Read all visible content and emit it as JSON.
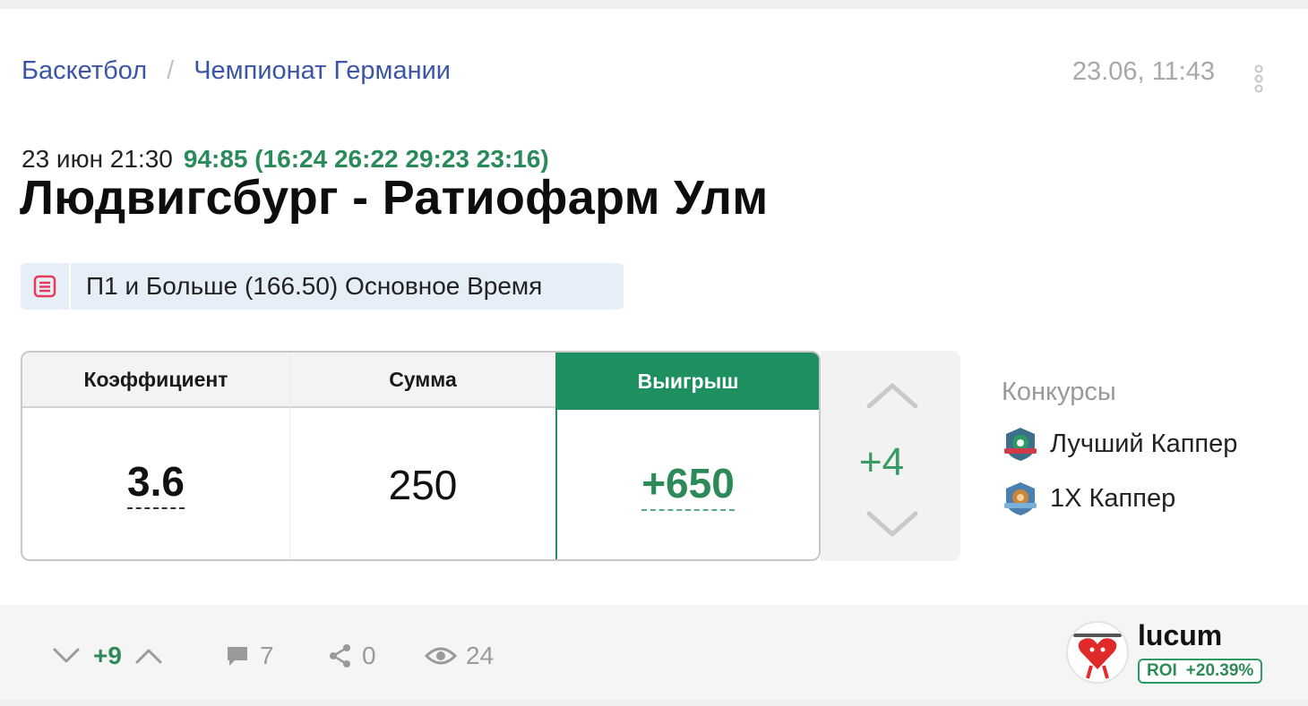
{
  "breadcrumb": {
    "sport": "Баскетбол",
    "separator": "/",
    "league": "Чемпионат Германии"
  },
  "post": {
    "date": "23.06, 11:43"
  },
  "match": {
    "time": "23 июн 21:30",
    "score": "94:85 (16:24 26:22 29:23 23:16)",
    "title": "Людвигсбург - Ратиофарм Улм"
  },
  "bet": {
    "label": "П1 и Больше (166.50) Основное Время"
  },
  "stakes": {
    "odds_header": "Коэффициент",
    "odds_value": "3.6",
    "sum_header": "Сумма",
    "sum_value": "250",
    "win_header": "Выигрыш",
    "win_value": "+650"
  },
  "votes": {
    "count": "+4"
  },
  "contests": {
    "title": "Конкурсы",
    "items": [
      {
        "label": "Лучший Каппер",
        "icon": "best-capper-badge-icon"
      },
      {
        "label": "1X Каппер",
        "icon": "1x-capper-badge-icon"
      }
    ]
  },
  "footer": {
    "rating": "+9",
    "comments": "7",
    "shares": "0",
    "views": "24"
  },
  "author": {
    "name": "lucum",
    "roi_label": "ROI",
    "roi_value": "+20.39%"
  },
  "colors": {
    "accent_green": "#1e8f60",
    "link_blue": "#3b56a6",
    "chip_bg": "#e6eef8"
  }
}
